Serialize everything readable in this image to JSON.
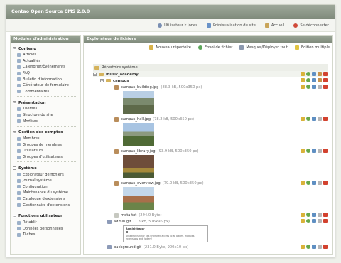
{
  "app": {
    "title": "Contao Open Source CMS 2.0.0"
  },
  "userbar": {
    "user": "Utilisateur k.jones",
    "preview": "Prévisualisation du site",
    "home": "Accueil",
    "logout": "Se déconnecter"
  },
  "sidebar": {
    "title": "Modules d'administration",
    "groups": [
      {
        "title": "Contenu",
        "items": [
          "Articles",
          "Actualités",
          "Calendrier/Événements",
          "FAQ",
          "Bulletin d'information",
          "Générateur de formulaire",
          "Commentaires"
        ]
      },
      {
        "title": "Présentation",
        "items": [
          "Thèmes",
          "Structure du site",
          "Modèles"
        ]
      },
      {
        "title": "Gestion des comptes",
        "items": [
          "Membres",
          "Groupes de membres",
          "Utilisateurs",
          "Groupes d'utilisateurs"
        ]
      },
      {
        "title": "Système",
        "items": [
          "Explorateur de fichiers",
          "Journal système",
          "Configuration",
          "Maintenance du système",
          "Catalogue d'extensions",
          "Gestionnaire d'extensions"
        ]
      },
      {
        "title": "Fonctions utilisateur",
        "items": [
          "Rétablir",
          "Données personnelles",
          "Tâches"
        ]
      }
    ]
  },
  "main": {
    "title": "Explorateur de fichiers",
    "toolbar": {
      "new_folder": "Nouveau répertoire",
      "upload": "Envoi de fichier",
      "toggle": "Masquer/Déployer tout",
      "multi_edit": "Edition multiple"
    },
    "tree": {
      "root": "Répertoire système",
      "folder1": "music_academy",
      "folder2": "campus",
      "files": [
        {
          "name": "campus_building.jpg",
          "meta": "(88.3 kB, 500x350 px)"
        },
        {
          "name": "campus_hall.jpg",
          "meta": "(78.2 kB, 500x350 px)"
        },
        {
          "name": "campus_library.jpg",
          "meta": "(93.9 kB, 500x350 px)"
        },
        {
          "name": "campus_overview.jpg",
          "meta": "(79.0 kB, 500x350 px)"
        }
      ],
      "meta_file": {
        "name": "meta.txt",
        "meta": "(294.0 Byte)"
      },
      "admin_file": {
        "name": "admin.gif",
        "meta": "(1.3 kB, 516x96 px)"
      },
      "admin_preview": {
        "title": "Administrator",
        "text": "An administrator has unlimited access to all pages, modules, extensions and folders!"
      },
      "bg_file": {
        "name": "background.gif",
        "meta": "(231.0 Byte, 900x10 px)"
      }
    }
  },
  "colors": {
    "header": "#8b9687",
    "accent": "#d04a3a"
  }
}
